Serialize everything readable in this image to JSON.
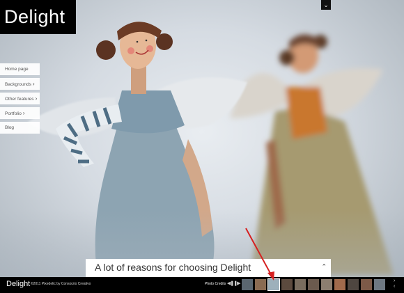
{
  "brand": {
    "name": "Delight"
  },
  "menu": {
    "items": [
      {
        "label": "Home page",
        "has_submenu": false
      },
      {
        "label": "Backgrounds",
        "has_submenu": true
      },
      {
        "label": "Other features",
        "has_submenu": true
      },
      {
        "label": "Portfolio",
        "has_submenu": true
      },
      {
        "label": "Blog",
        "has_submenu": false
      }
    ]
  },
  "caption": {
    "title": "A lot of reasons for choosing Delight"
  },
  "footer": {
    "logo": "Delight",
    "copyright": "©2011 Pixedelic by Consorzio Creativo",
    "credits_label": "Photo Credits"
  },
  "thumbnails": {
    "count": 12,
    "active_index": 2
  },
  "colors": {
    "bar": "#000000",
    "annotation_arrow": "#d62020"
  }
}
